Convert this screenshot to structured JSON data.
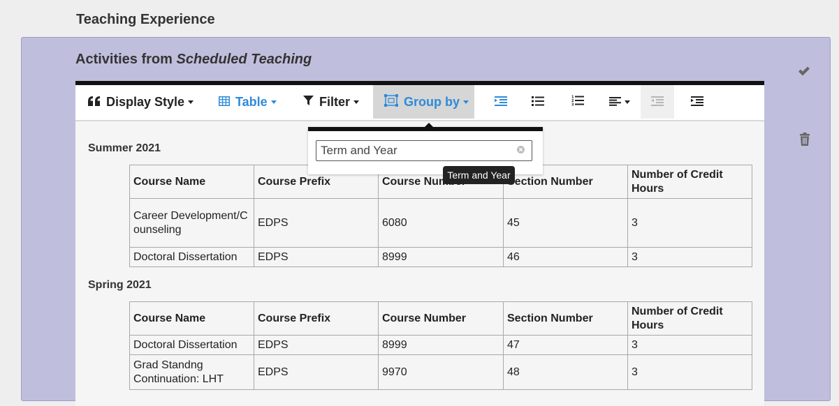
{
  "page": {
    "section_title": "Teaching Experience",
    "panel_title_prefix": "Activities from ",
    "panel_title_emphasis": "Scheduled Teaching"
  },
  "toolbar": {
    "display_style": "Display Style",
    "table": "Table",
    "filter": "Filter",
    "group_by": "Group by",
    "accent_color": "#2f8ad8"
  },
  "group_by_popover": {
    "selected_value": "Term and Year",
    "tooltip": "Term and Year"
  },
  "groups": [
    {
      "heading": "Summer 2021",
      "columns": [
        "Course Name",
        "Course Prefix",
        "Course Number",
        "Section Number",
        "Number of Credit Hours"
      ],
      "rows": [
        [
          "Career Development/Counseling",
          "EDPS",
          "6080",
          "45",
          "3"
        ],
        [
          "Doctoral Dissertation",
          "EDPS",
          "8999",
          "46",
          "3"
        ]
      ]
    },
    {
      "heading": "Spring 2021",
      "columns": [
        "Course Name",
        "Course Prefix",
        "Course Number",
        "Section Number",
        "Number of Credit Hours"
      ],
      "rows": [
        [
          "Doctoral Dissertation",
          "EDPS",
          "8999",
          "47",
          "3"
        ],
        [
          "Grad Standng Continuation: LHT",
          "EDPS",
          "9970",
          "48",
          "3"
        ]
      ]
    }
  ]
}
